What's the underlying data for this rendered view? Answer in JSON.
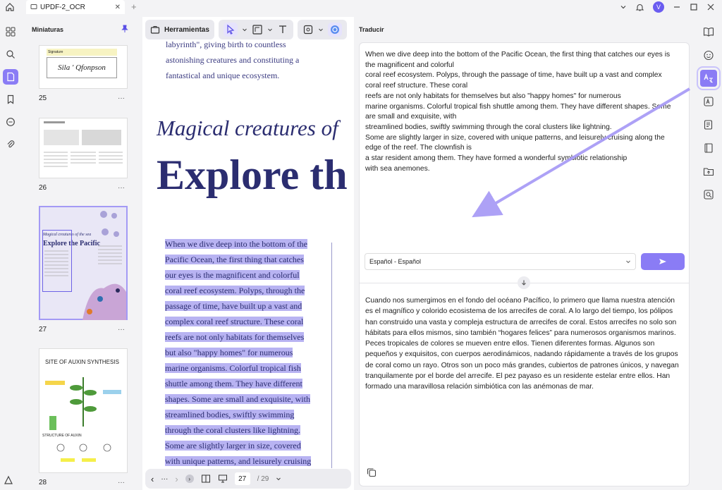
{
  "titlebar": {
    "tab_title": "UPDF-2_OCR"
  },
  "avatar": {
    "letter": "V"
  },
  "thumbnails": {
    "heading": "Miniaturas",
    "pages": [
      {
        "number": "25",
        "signature_label": "Signature",
        "signature_name": "Sila ' Qfonpson"
      },
      {
        "number": "26"
      },
      {
        "number": "27",
        "thumb_title": "Explore the Pacific",
        "thumb_subtitle": "Magical creatures of the sea"
      },
      {
        "number": "28",
        "thumb_title": "SITE OF AUXIN SYNTHESIS",
        "thumb_subtitle": "STRUCTURE OF AUXIN"
      }
    ]
  },
  "toolbar": {
    "tools_label": "Herramientas"
  },
  "document": {
    "top_lines": [
      "labyrinth\", giving birth to countless",
      "astonishing creatures and constituting a",
      "fantastical and unique ecosystem."
    ],
    "italic_heading": "Magical creatures of",
    "big_heading": "Explore th",
    "highlighted_lines": [
      "When we dive deep into the bottom of the",
      "Pacific Ocean, the first thing that catches",
      "our eyes is the magnificent and colorful",
      "coral reef ecosystem. Polyps, through the",
      "passage of time, have built up a vast and",
      "complex coral reef structure. These coral",
      "reefs are not only habitats for themselves",
      "but also \"happy homes\" for numerous",
      "marine organisms. Colorful tropical fish",
      "shuttle among them. They have different",
      "shapes. Some are small and exquisite, with",
      "streamlined bodies, swiftly swimming",
      "through the coral clusters like lightning.",
      "Some are slightly larger in size, covered",
      "with unique patterns, and leisurely cruising"
    ]
  },
  "pager": {
    "current_page": "27",
    "total_pages": "/ 29"
  },
  "translate": {
    "heading": "Traducir",
    "source_lines": [
      "When we dive deep into the bottom of the Pacific Ocean, the first thing that catches our eyes is",
      "the magnificent and colorful",
      "coral reef ecosystem. Polyps, through the passage of time, have built up a vast and complex",
      "coral reef structure. These coral",
      "reefs are not only habitats for themselves but also \"happy homes\" for numerous",
      "marine organisms. Colorful tropical fish shuttle among them. They have different shapes. Some",
      "are small and exquisite, with",
      "streamlined bodies, swiftly swimming through the coral clusters like lightning.",
      "Some are slightly larger in size, covered with unique patterns, and leisurely cruising along the",
      "edge of the reef. The clownfish is",
      "a star resident among them. They have formed a wonderful symbiotic relationship",
      "with sea anemones."
    ],
    "language_value": "Español - Español",
    "result_text": "Cuando nos sumergimos en el fondo del océano Pacífico, lo primero que llama nuestra atención es el magnífico y colorido ecosistema de los arrecifes de coral. A lo largo del tiempo, los pólipos han construido una vasta y compleja estructura de arrecifes de coral. Estos arrecifes no solo son hábitats para ellos mismos, sino también “hogares felices” para numerosos organismos marinos. Peces tropicales de colores se mueven entre ellos. Tienen diferentes formas. Algunos son pequeños y exquisitos, con cuerpos aerodinámicos, nadando rápidamente a través de los grupos de coral como un rayo. Otros son un poco más grandes, cubiertos de patrones únicos, y navegan tranquilamente por el borde del arrecife. El pez payaso es un residente estelar entre ellos. Han formado una maravillosa relación simbiótica con las anémonas de mar."
  },
  "colors": {
    "accent": "#8a7cf5",
    "highlight": "#b8b3f2",
    "heading_text": "#2b2d70"
  }
}
